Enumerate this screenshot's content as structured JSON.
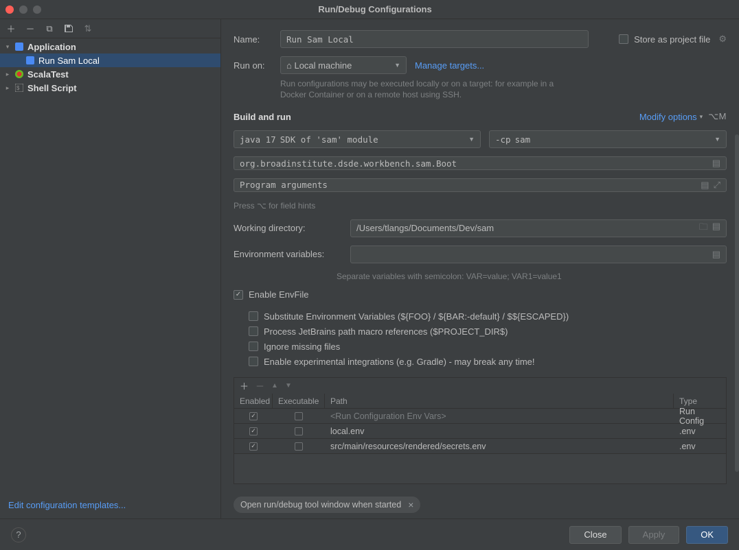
{
  "window": {
    "title": "Run/Debug Configurations"
  },
  "sidebar": {
    "items": [
      {
        "label": "Application",
        "icon": "app",
        "children": [
          {
            "label": "Run Sam Local",
            "icon": "run"
          }
        ]
      },
      {
        "label": "ScalaTest",
        "icon": "scala"
      },
      {
        "label": "Shell Script",
        "icon": "shell"
      }
    ],
    "edit_templates": "Edit configuration templates..."
  },
  "form": {
    "name_label": "Name:",
    "name_value": "Run Sam Local",
    "store_label": "Store as project file",
    "run_on_label": "Run on:",
    "run_on_value": "Local machine",
    "manage_targets": "Manage targets...",
    "run_on_hint": "Run configurations may be executed locally or on a target: for example in a Docker Container or on a remote host using SSH.",
    "build_run_title": "Build and run",
    "modify_options": "Modify options",
    "modify_shortcut": "⌥M",
    "jdk_value": "java 17",
    "jdk_hint": "SDK of 'sam' module",
    "cp_prefix": "-cp",
    "cp_value": "sam",
    "main_class": "org.broadinstitute.dsde.workbench.sam.Boot",
    "args_placeholder": "Program arguments",
    "hints_text": "Press ⌥ for field hints",
    "wd_label": "Working directory:",
    "wd_value": "/Users/tlangs/Documents/Dev/sam",
    "env_label": "Environment variables:",
    "env_hint": "Separate variables with semicolon: VAR=value; VAR1=value1",
    "enable_envfile": "Enable EnvFile",
    "opt_subst": "Substitute Environment Variables (${FOO} / ${BAR:-default} / $${ESCAPED})",
    "opt_macro": "Process JetBrains path macro references ($PROJECT_DIR$)",
    "opt_ignore": "Ignore missing files",
    "opt_exper": "Enable experimental integrations (e.g. Gradle) - may break any time!",
    "table": {
      "headers": {
        "enabled": "Enabled",
        "exec": "Executable",
        "path": "Path",
        "type": "Type"
      },
      "rows": [
        {
          "enabled": true,
          "exec": false,
          "path": "<Run Configuration Env Vars>",
          "type": "Run Config",
          "muted": true
        },
        {
          "enabled": true,
          "exec": false,
          "path": "local.env",
          "type": ".env"
        },
        {
          "enabled": true,
          "exec": false,
          "path": "src/main/resources/rendered/secrets.env",
          "type": ".env"
        }
      ]
    },
    "chip": "Open run/debug tool window when started"
  },
  "footer": {
    "close": "Close",
    "apply": "Apply",
    "ok": "OK"
  }
}
